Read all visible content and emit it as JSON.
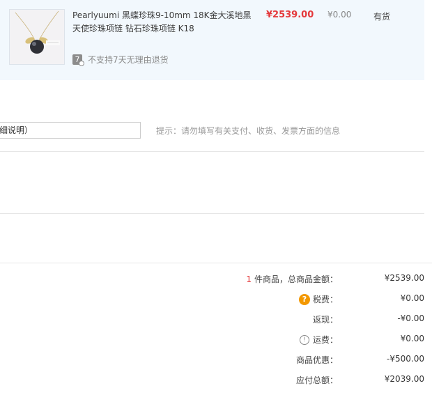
{
  "product": {
    "title_line1": "Pearlyuumi 黑蝶珍珠9-10mm 18K金大溪地黑",
    "title_line2": "天使珍珠项链 钻石珍珠项链 K18",
    "price": "¥2539.00",
    "tax": "¥0.00",
    "status": "有货",
    "return_icon_text": "7",
    "return_policy": "不支持7天无理由退货",
    "image_icon": "pearl-necklace-thumbnail"
  },
  "remark": {
    "input_value": "细说明）",
    "hint": "提示：请勿填写有关支付、收货、发票方面的信息"
  },
  "summary": {
    "count": "1",
    "count_label": "件商品，总商品金额：",
    "goods_total": "¥2539.00",
    "tax_label": "税费：",
    "tax_value": "¥0.00",
    "cashback_label": "返现：",
    "cashback_value": "-¥0.00",
    "shipping_label": "运费：",
    "shipping_value": "¥0.00",
    "discount_label": "商品优惠：",
    "discount_value": "-¥500.00",
    "payable_label": "应付总额：",
    "payable_value": "¥2039.00"
  },
  "colors": {
    "price_red": "#e4393c",
    "row_bg": "#f2f8fd",
    "help_orange": "#f39800"
  }
}
